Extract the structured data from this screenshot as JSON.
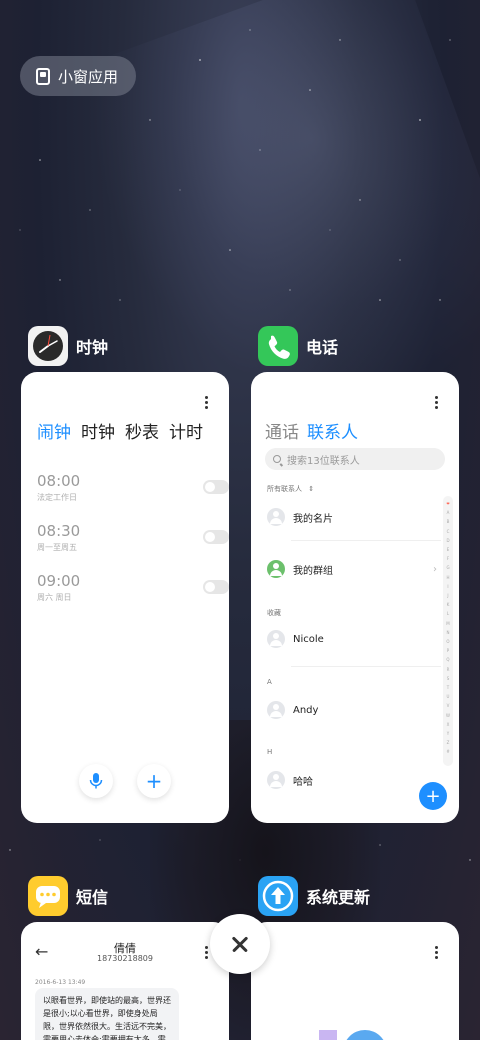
{
  "floating_apps": {
    "label": "小窗应用"
  },
  "apps": {
    "clock": {
      "name": "时钟",
      "tabs": [
        "闹钟",
        "时钟",
        "秒表",
        "计时"
      ],
      "alarms": [
        {
          "time": "08:00",
          "repeat": "法定工作日"
        },
        {
          "time": "08:30",
          "repeat": "周一至周五"
        },
        {
          "time": "09:00",
          "repeat": "周六 周日"
        }
      ]
    },
    "phone": {
      "name": "电话",
      "tabs": [
        "通话",
        "联系人"
      ],
      "search_placeholder": "搜索13位联系人",
      "filter_label": "所有联系人",
      "my_card": "我的名片",
      "my_groups": "我的群组",
      "sections": [
        {
          "header": "收藏",
          "contact": "Nicole"
        },
        {
          "header": "A",
          "contact": "Andy"
        },
        {
          "header": "H",
          "contact": "哈哈"
        }
      ],
      "alphabet": [
        "❤",
        "A",
        "B",
        "C",
        "D",
        "E",
        "F",
        "G",
        "H",
        "I",
        "J",
        "K",
        "L",
        "M",
        "N",
        "O",
        "P",
        "Q",
        "R",
        "S",
        "T",
        "U",
        "V",
        "W",
        "X",
        "Y",
        "Z",
        "#"
      ]
    },
    "sms": {
      "name": "短信",
      "contact_name": "倩倩",
      "contact_number": "18730218809",
      "date": "2016-6-13 13:49",
      "message": "以眼看世界，即使站的最高，世界还是很小;以心看世界，即使身处局限，世界依然很大。生活远不完美，需要用心去体会;需要拥有太多，需"
    },
    "updater": {
      "name": "系统更新"
    }
  },
  "colors": {
    "accent": "#1e8fff",
    "phone_green": "#34c759",
    "sms_yellow": "#ffcc2e",
    "update_blue": "#2aa3f4"
  }
}
